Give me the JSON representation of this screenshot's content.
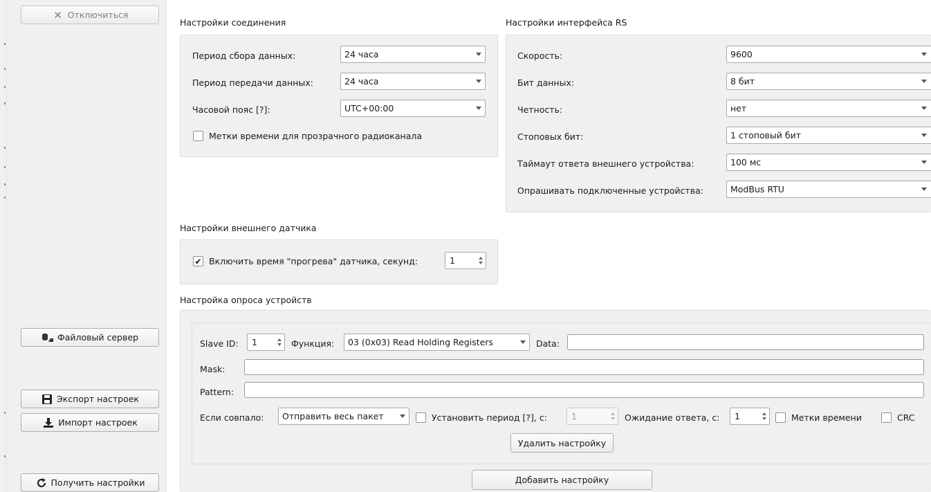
{
  "sidebar": {
    "disconnect_button": "Отключиться",
    "file_server_button": "Файловый сервер",
    "export_button": "Экспорт настроек",
    "import_button": "Импорт настроек",
    "get_settings_button": "Получить настройки"
  },
  "connection": {
    "title": "Настройки соединения",
    "collect_label": "Период сбора данных:",
    "collect_value": "24 часа",
    "transmit_label": "Период передачи данных:",
    "transmit_value": "24 часа",
    "tz_label": "Часовой пояс [?]:",
    "tz_value": "UTC+00:00",
    "timestamps_label": "Метки времени для прозрачного радиоканала",
    "timestamps_checked": false
  },
  "rs": {
    "title": "Настройки интерфейса RS",
    "speed_label": "Скорость:",
    "speed_value": "9600",
    "databits_label": "Бит данных:",
    "databits_value": "8 бит",
    "parity_label": "Четность:",
    "parity_value": "нет",
    "stopbits_label": "Стоповых бит:",
    "stopbits_value": "1 стоповый бит",
    "timeout_label": "Таймаут ответа внешнего устройства:",
    "timeout_value": "100 мс",
    "poll_label": "Опрашивать подключенные устройства:",
    "poll_value": "ModBus RTU"
  },
  "sensor": {
    "title": "Настройки внешнего датчика",
    "warmup_label": "Включить время \"прогрева\" датчика, секунд:",
    "warmup_checked": true,
    "warmup_value": "1"
  },
  "poll": {
    "title": "Настройка опроса устройств",
    "slave_label": "Slave ID:",
    "slave_value": "1",
    "func_label": "Функция:",
    "func_value": "03 (0x03) Read Holding Registers",
    "data_label": "Data:",
    "data_value": "",
    "mask_label": "Mask:",
    "mask_value": "",
    "pattern_label": "Pattern:",
    "pattern_value": "",
    "match_label": "Если совпало:",
    "match_value": "Отправить весь пакет",
    "period_label": "Установить период [?], с:",
    "period_value": "1",
    "wait_label": "Ожидание ответа, с:",
    "wait_value": "1",
    "ts_label": "Метки времени",
    "crc_label": "CRC",
    "delete_button": "Удалить настройку",
    "add_button": "Добавить настройку"
  },
  "colors": {
    "panel_bg": "#f0f0f0",
    "border": "#dcdcdc"
  }
}
